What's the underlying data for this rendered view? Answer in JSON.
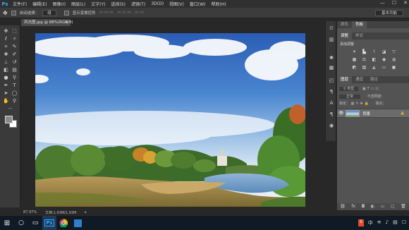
{
  "app": {
    "logo": "Ps"
  },
  "menu": [
    "文件(F)",
    "编辑(E)",
    "图像(I)",
    "图层(L)",
    "文字(Y)",
    "选择(S)",
    "滤镜(T)",
    "3D(D)",
    "视图(V)",
    "窗口(W)",
    "帮助(H)"
  ],
  "window_controls": [
    "—",
    "☐",
    "✕"
  ],
  "options_bar": {
    "auto_select_label": "自动选择：",
    "auto_select_value": "组",
    "show_transform_label": "显示变换控件",
    "workspace": "基本功能"
  },
  "document": {
    "tab_title": "风光图.jpg @ 88%(RGB/8)",
    "close": "×"
  },
  "statusbar": {
    "zoom": "87.97%",
    "doc_info": "文档:1.93M/1.93M"
  },
  "panels": {
    "top_tabs": [
      "颜色",
      "色板"
    ],
    "adj_tabs": [
      "调整",
      "样式"
    ],
    "adjust_title": "添加调整",
    "layer_tabs": [
      "图层",
      "通道",
      "路径"
    ],
    "kind_label": "类型",
    "blend_mode": "正常",
    "opacity_label": "不透明度：",
    "lock_label": "锁定：",
    "fill_label": "填充：",
    "layer_name": "背景",
    "layer_lock": "🔒"
  },
  "taskbar": {
    "tray_text": "中"
  },
  "colors": {
    "ps_blue": "#31a8ff",
    "sky_top": "#2c5fb8",
    "sky_low": "#c6dcef"
  }
}
